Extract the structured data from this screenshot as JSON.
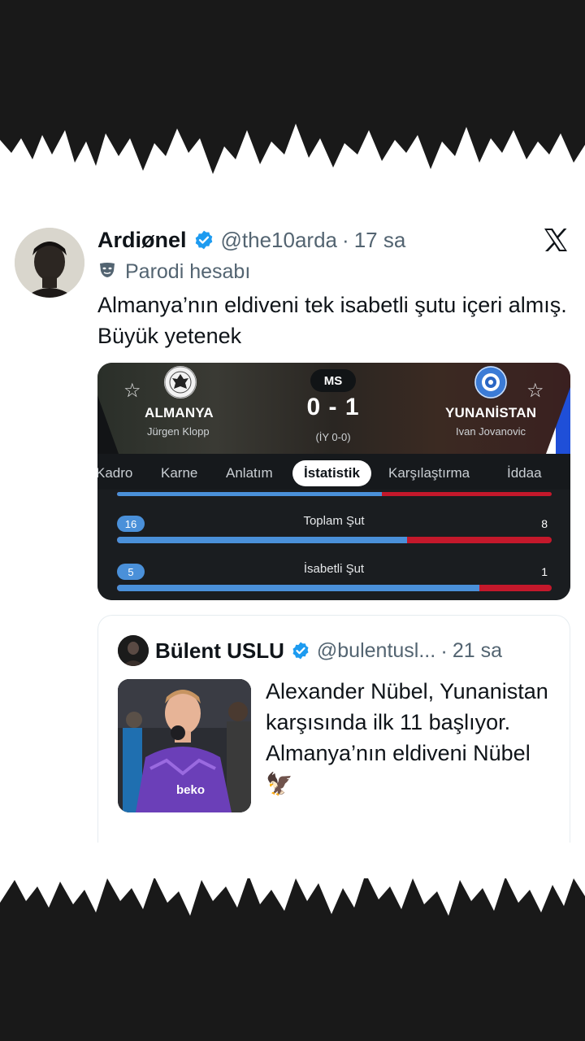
{
  "tweet": {
    "author_name": "Ardiønel",
    "handle": "@the10arda",
    "separator": "·",
    "time": "17 sa",
    "parody_label": "Parodi hesabı",
    "text": "Almanya’nın eldiveni tek isabetli şutu içeri almış. Büyük yetenek"
  },
  "match": {
    "status": "MS",
    "score": "0 - 1",
    "halftime": "(İY 0-0)",
    "home": {
      "name": "ALMANYA",
      "coach": "Jürgen Klopp"
    },
    "away": {
      "name": "YUNANİSTAN",
      "coach": "Ivan Jovanovic"
    },
    "tabs": [
      "Kadro",
      "Karne",
      "Anlatım",
      "İstatistik",
      "Karşılaştırma",
      "İddaa"
    ],
    "active_tab": "İstatistik",
    "stats": [
      {
        "label": "Toplam Şut",
        "home": "16",
        "away": "8",
        "home_share": 0.667
      },
      {
        "label": "İsabetli Şut",
        "home": "5",
        "away": "1",
        "home_share": 0.833
      }
    ],
    "top_bar_share": 0.61,
    "colors": {
      "home_bar": "#4a90d9",
      "away_bar": "#c4182b"
    }
  },
  "quote": {
    "author_name": "Bülent USLU",
    "handle": "@bulentusl...",
    "separator": "·",
    "time": "21 sa",
    "text": "Alexander Nübel, Yunanistan karşısında ilk 11 başlıyor. Almanya’nın eldiveni Nübel 🦅",
    "image_text": "beko"
  },
  "colors": {
    "verified": "#1d9bf0",
    "text": "#0f1419",
    "muted": "#536471"
  }
}
